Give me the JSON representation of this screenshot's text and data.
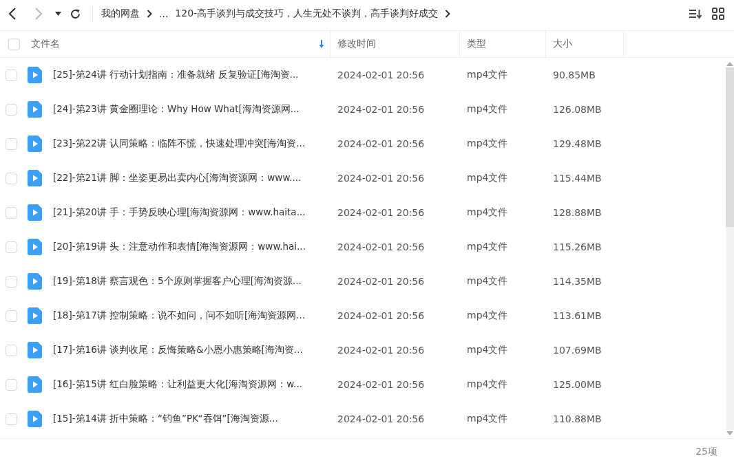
{
  "nav": {
    "back_disabled": false,
    "forward_disabled": true
  },
  "breadcrumb": {
    "root": "我的网盘",
    "ellipsis": "...",
    "current": "120-高手谈判与成交技巧，人生无处不谈判，高手谈判好成交"
  },
  "header": {
    "checked": false,
    "columns": [
      {
        "label": "文件名",
        "sorted": true
      },
      {
        "label": "修改时间",
        "sorted": false
      },
      {
        "label": "类型",
        "sorted": false
      },
      {
        "label": "大小",
        "sorted": false
      }
    ]
  },
  "rows": [
    {
      "checked": false,
      "name": "[25]-第24讲 行动计划指南：准备就绪 反复验证[海淘资...",
      "modified": "2024-02-01 20:56",
      "type": "mp4文件",
      "size": "90.85MB"
    },
    {
      "checked": false,
      "name": "[24]-第23讲 黄金圈理论：Why How What[海淘资源网...",
      "modified": "2024-02-01 20:56",
      "type": "mp4文件",
      "size": "126.08MB"
    },
    {
      "checked": false,
      "name": "[23]-第22讲 认同策略：临阵不慌，快速处理冲突[海淘资...",
      "modified": "2024-02-01 20:56",
      "type": "mp4文件",
      "size": "129.48MB"
    },
    {
      "checked": false,
      "name": "[22]-第21讲 脚：坐姿更易出卖内心[海淘资源网：www....",
      "modified": "2024-02-01 20:56",
      "type": "mp4文件",
      "size": "115.44MB"
    },
    {
      "checked": false,
      "name": "[21]-第20讲 手：手势反映心理[海淘资源网：www.haita...",
      "modified": "2024-02-01 20:56",
      "type": "mp4文件",
      "size": "128.88MB"
    },
    {
      "checked": false,
      "name": "[20]-第19讲 头：注意动作和表情[海淘资源网：www.hai...",
      "modified": "2024-02-01 20:56",
      "type": "mp4文件",
      "size": "115.26MB"
    },
    {
      "checked": false,
      "name": "[19]-第18讲 察言观色：5个原则掌握客户心理[海淘资源...",
      "modified": "2024-02-01 20:56",
      "type": "mp4文件",
      "size": "114.35MB"
    },
    {
      "checked": false,
      "name": "[18]-第17讲 控制策略：说不如问，问不如听[海淘资源网...",
      "modified": "2024-02-01 20:56",
      "type": "mp4文件",
      "size": "113.61MB"
    },
    {
      "checked": false,
      "name": "[17]-第16讲 谈判收尾：反悔策略&小恩小惠策略[海淘资...",
      "modified": "2024-02-01 20:56",
      "type": "mp4文件",
      "size": "107.69MB"
    },
    {
      "checked": false,
      "name": "[16]-第15讲 红白脸策略：让利益更大化[海淘资源网：w...",
      "modified": "2024-02-01 20:56",
      "type": "mp4文件",
      "size": "125.00MB"
    },
    {
      "checked": false,
      "name": "[15]-第14讲 折中策略：“钓鱼”PK“吞饵”[海淘资源...",
      "modified": "2024-02-01 20:56",
      "type": "mp4文件",
      "size": "110.88MB"
    }
  ],
  "status_bar": {
    "count": "25项"
  }
}
